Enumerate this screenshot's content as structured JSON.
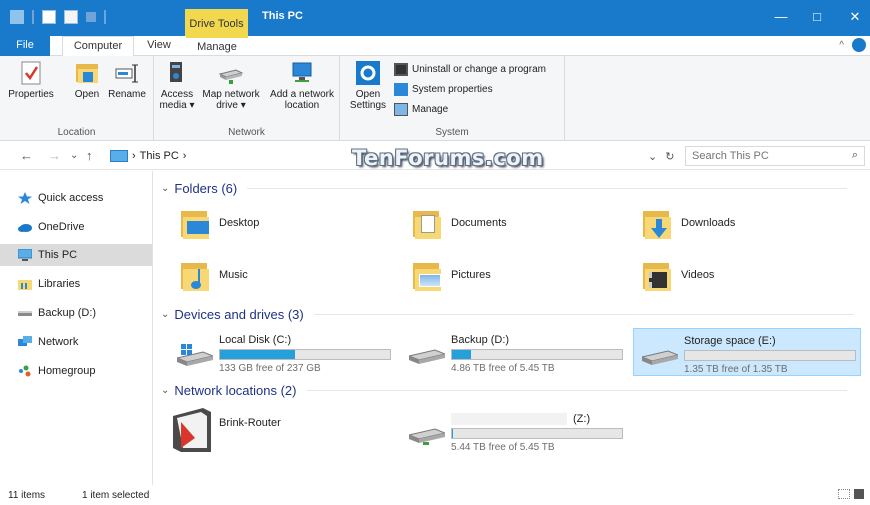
{
  "title_bar": {
    "context_tab": "Drive Tools",
    "title": "This PC",
    "minimize": "—",
    "maximize": "□",
    "close": "✕"
  },
  "ribbon_tabs": {
    "file": "File",
    "computer": "Computer",
    "view": "View",
    "manage": "Manage",
    "collapse": "^"
  },
  "ribbon": {
    "location": {
      "label": "Location",
      "properties": "Properties",
      "open": "Open",
      "rename": "Rename"
    },
    "network": {
      "label": "Network",
      "access_media": "Access media ▾",
      "map_network_drive": "Map network drive ▾",
      "add_network_location": "Add a network location"
    },
    "system": {
      "label": "System",
      "open_settings": "Open Settings",
      "uninstall": "Uninstall or change a program",
      "system_properties": "System properties",
      "manage": "Manage"
    }
  },
  "address": {
    "back": "←",
    "forward": "→",
    "recent": "⌄",
    "up": "↑",
    "crumbs": [
      "›",
      "This PC",
      "›"
    ],
    "dropdown": "⌄",
    "refresh": "↻",
    "search_placeholder": "Search This PC",
    "search_icon": "⌕"
  },
  "watermark": "TenForums.com",
  "nav_pane": [
    {
      "label": "Quick access",
      "icon": "star-icon"
    },
    {
      "label": "OneDrive",
      "icon": "cloud-icon"
    },
    {
      "label": "This PC",
      "icon": "computer-icon",
      "selected": true
    },
    {
      "label": "Libraries",
      "icon": "libraries-icon"
    },
    {
      "label": "Backup (D:)",
      "icon": "drive-icon"
    },
    {
      "label": "Network",
      "icon": "network-icon"
    },
    {
      "label": "Homegroup",
      "icon": "homegroup-icon"
    }
  ],
  "sections": {
    "folders": "Folders (6)",
    "devices": "Devices and drives (3)",
    "network": "Network locations (2)"
  },
  "folders": [
    "Desktop",
    "Documents",
    "Downloads",
    "Music",
    "Pictures",
    "Videos"
  ],
  "drives": [
    {
      "name": "Local Disk (C:)",
      "free": "133 GB free of 237 GB",
      "used_fraction": 0.44,
      "selected": false
    },
    {
      "name": "Backup (D:)",
      "free": "4.86 TB free of 5.45 TB",
      "used_fraction": 0.11,
      "selected": false
    },
    {
      "name": "Storage space (E:)",
      "free": "1.35 TB free of 1.35 TB",
      "used_fraction": 0.0,
      "selected": true
    }
  ],
  "network_locations": [
    {
      "name": "Brink-Router"
    },
    {
      "name": "(Z:)",
      "free": "5.44 TB free of 5.45 TB",
      "used_fraction": 0.002
    }
  ],
  "status": {
    "items": "11 items",
    "selected": "1 item selected"
  },
  "colors": {
    "accent": "#1979ca",
    "context": "#f1d84f",
    "bar_fill": "#26a0da",
    "selection": "#cce8ff",
    "section_text": "#1e3287"
  }
}
